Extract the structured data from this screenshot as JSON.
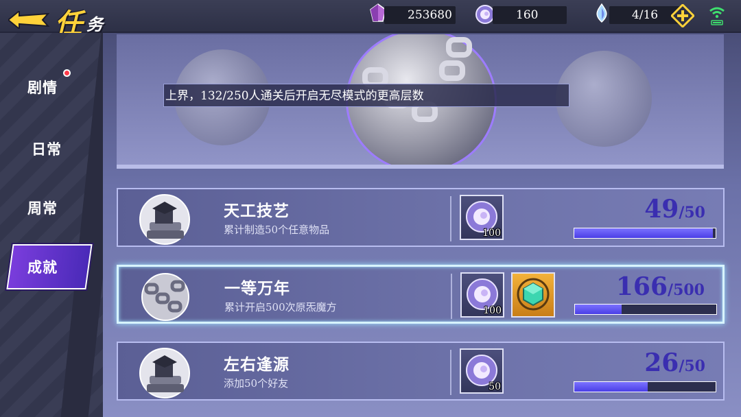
{
  "header": {
    "title_big": "任",
    "title_small": "务"
  },
  "resources": [
    {
      "name": "gem",
      "value": "253680",
      "icon": "purple-crystal-icon",
      "color": "#b86ad6"
    },
    {
      "name": "orb",
      "value": "160",
      "icon": "purple-orb-icon",
      "color": "#b8a6f0"
    },
    {
      "name": "stamina",
      "value": "4/16",
      "icon": "water-drop-icon",
      "color": "#a9d8ff"
    }
  ],
  "sidebar": {
    "items": [
      {
        "label": "剧情",
        "has_dot": true
      },
      {
        "label": "日常",
        "has_dot": false
      },
      {
        "label": "周常",
        "has_dot": false
      },
      {
        "label": "成就",
        "active": true
      }
    ]
  },
  "tooltip": {
    "text": "上界，132/250人通关后开启无尽模式的更高层数"
  },
  "achievements": [
    {
      "title": "天工技艺",
      "desc": "累计制造50个任意物品",
      "icon": "books-emblem-icon",
      "rewards": [
        {
          "icon": "purple-orb-icon",
          "count": "100"
        }
      ],
      "progress": {
        "current": "49",
        "max": "/50",
        "fraction": 0.98
      }
    },
    {
      "title": "一等万年",
      "desc": "累计开启500次原炁魔方",
      "icon": "chained-medal-icon",
      "rewards": [
        {
          "icon": "purple-orb-icon",
          "count": "100"
        },
        {
          "icon": "green-cube-icon",
          "count": ""
        }
      ],
      "progress": {
        "current": "166",
        "max": "/500",
        "fraction": 0.332
      }
    },
    {
      "title": "左右逢源",
      "desc": "添加50个好友",
      "icon": "books-emblem-icon",
      "rewards": [
        {
          "icon": "purple-orb-icon",
          "count": "50"
        }
      ],
      "progress": {
        "current": "26",
        "max": "/50",
        "fraction": 0.52
      }
    }
  ]
}
